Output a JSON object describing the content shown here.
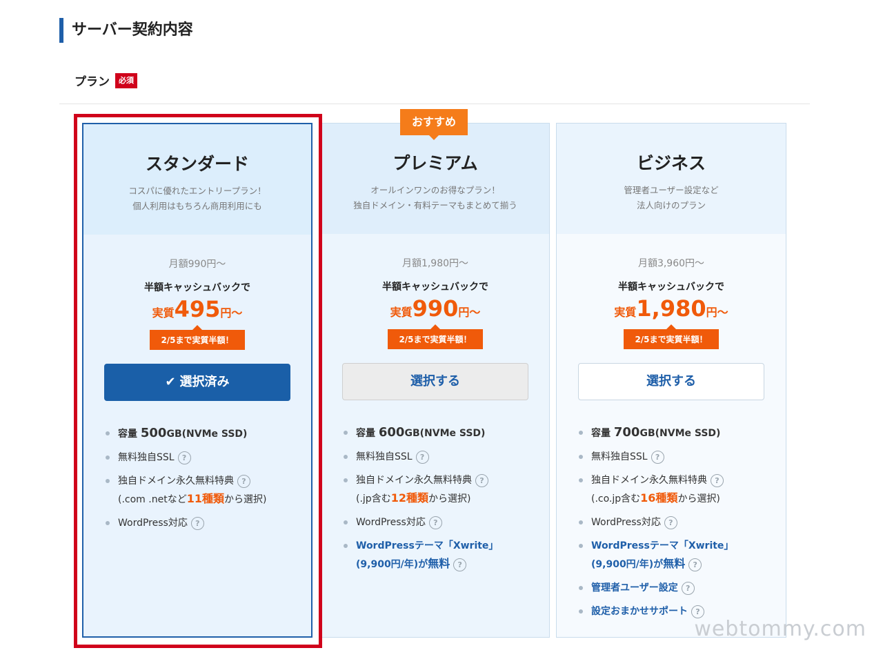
{
  "section": {
    "title": "サーバー契約内容"
  },
  "plan_label": {
    "text": "プラン",
    "required": "必須"
  },
  "recommend_badge": "おすすめ",
  "cards": [
    {
      "name": "スタンダード",
      "tagline1": "コスパに優れたエントリープラン！",
      "tagline2": "個人利用はもちろん商用利用にも",
      "monthly": "月額990円〜",
      "cashback": "半額キャッシュバックで",
      "effective_pre": "実質",
      "effective_num": "495",
      "effective_suf": "円〜",
      "deadline": "2/5まで実質半額！",
      "button_label": "選択済み",
      "button_state": "selected",
      "features": {
        "capacity_pre": "容量 ",
        "capacity_val": "500",
        "capacity_unit": "GB(NVMe SSD)",
        "ssl": "無料独自SSL",
        "domain_line1": "独自ドメイン永久無料特典",
        "domain_pre": "(.com .netなど",
        "domain_num": "11種類",
        "domain_suf": "から選択)",
        "wordpress": "WordPress対応"
      }
    },
    {
      "name": "プレミアム",
      "tagline1": "オールインワンのお得なプラン！",
      "tagline2": "独自ドメイン・有料テーマもまとめて揃う",
      "monthly": "月額1,980円〜",
      "cashback": "半額キャッシュバックで",
      "effective_pre": "実質",
      "effective_num": "990",
      "effective_suf": "円〜",
      "deadline": "2/5まで実質半額！",
      "button_label": "選択する",
      "button_state": "unselected",
      "features": {
        "capacity_pre": "容量 ",
        "capacity_val": "600",
        "capacity_unit": "GB(NVMe SSD)",
        "ssl": "無料独自SSL",
        "domain_line1": "独自ドメイン永久無料特典",
        "domain_pre": "(.jp含む",
        "domain_num": "12種類",
        "domain_suf": "から選択)",
        "wordpress": "WordPress対応",
        "theme_line1": "WordPressテーマ「Xwrite」",
        "theme_pre": "(9,900円/年)が",
        "theme_free": "無料"
      }
    },
    {
      "name": "ビジネス",
      "tagline1": "管理者ユーザー設定など",
      "tagline2": "法人向けのプラン",
      "monthly": "月額3,960円〜",
      "cashback": "半額キャッシュバックで",
      "effective_pre": "実質",
      "effective_num": "1,980",
      "effective_suf": "円〜",
      "deadline": "2/5まで実質半額！",
      "button_label": "選択する",
      "button_state": "unselected",
      "features": {
        "capacity_pre": "容量 ",
        "capacity_val": "700",
        "capacity_unit": "GB(NVMe SSD)",
        "ssl": "無料独自SSL",
        "domain_line1": "独自ドメイン永久無料特典",
        "domain_pre": "(.co.jp含む",
        "domain_num": "16種類",
        "domain_suf": "から選択)",
        "wordpress": "WordPress対応",
        "theme_line1": "WordPressテーマ「Xwrite」",
        "theme_pre": "(9,900円/年)が",
        "theme_free": "無料",
        "admin": "管理者ユーザー設定",
        "support": "設定おまかせサポート"
      }
    }
  ],
  "icons": {
    "help": "?",
    "check": "✔"
  },
  "colors": {
    "accent": "#1f5fa9",
    "orange": "#f05a0a",
    "highlight": "#d0021b"
  },
  "watermark": "webtommy.com"
}
